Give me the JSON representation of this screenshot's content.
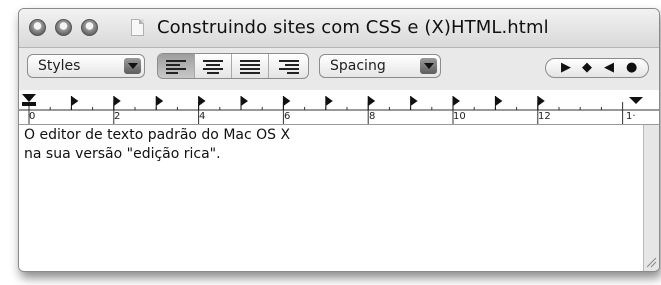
{
  "window": {
    "title": "Construindo sites com  CSS e (X)HTML.html"
  },
  "toolbar": {
    "styles_label": "Styles",
    "spacing_label": "Spacing",
    "align_buttons": [
      "align-left",
      "align-center",
      "align-justify",
      "align-right"
    ],
    "active_align": "align-left",
    "nav_glyphs": [
      "▶",
      "◆",
      "◀",
      "●"
    ]
  },
  "ruler": {
    "labels": [
      "0",
      "2",
      "4",
      "6",
      "8",
      "10",
      "12",
      "1·"
    ]
  },
  "document": {
    "lines": [
      "O editor de texto padrão do Mac OS X",
      "na sua versão \"edição rica\"."
    ]
  }
}
